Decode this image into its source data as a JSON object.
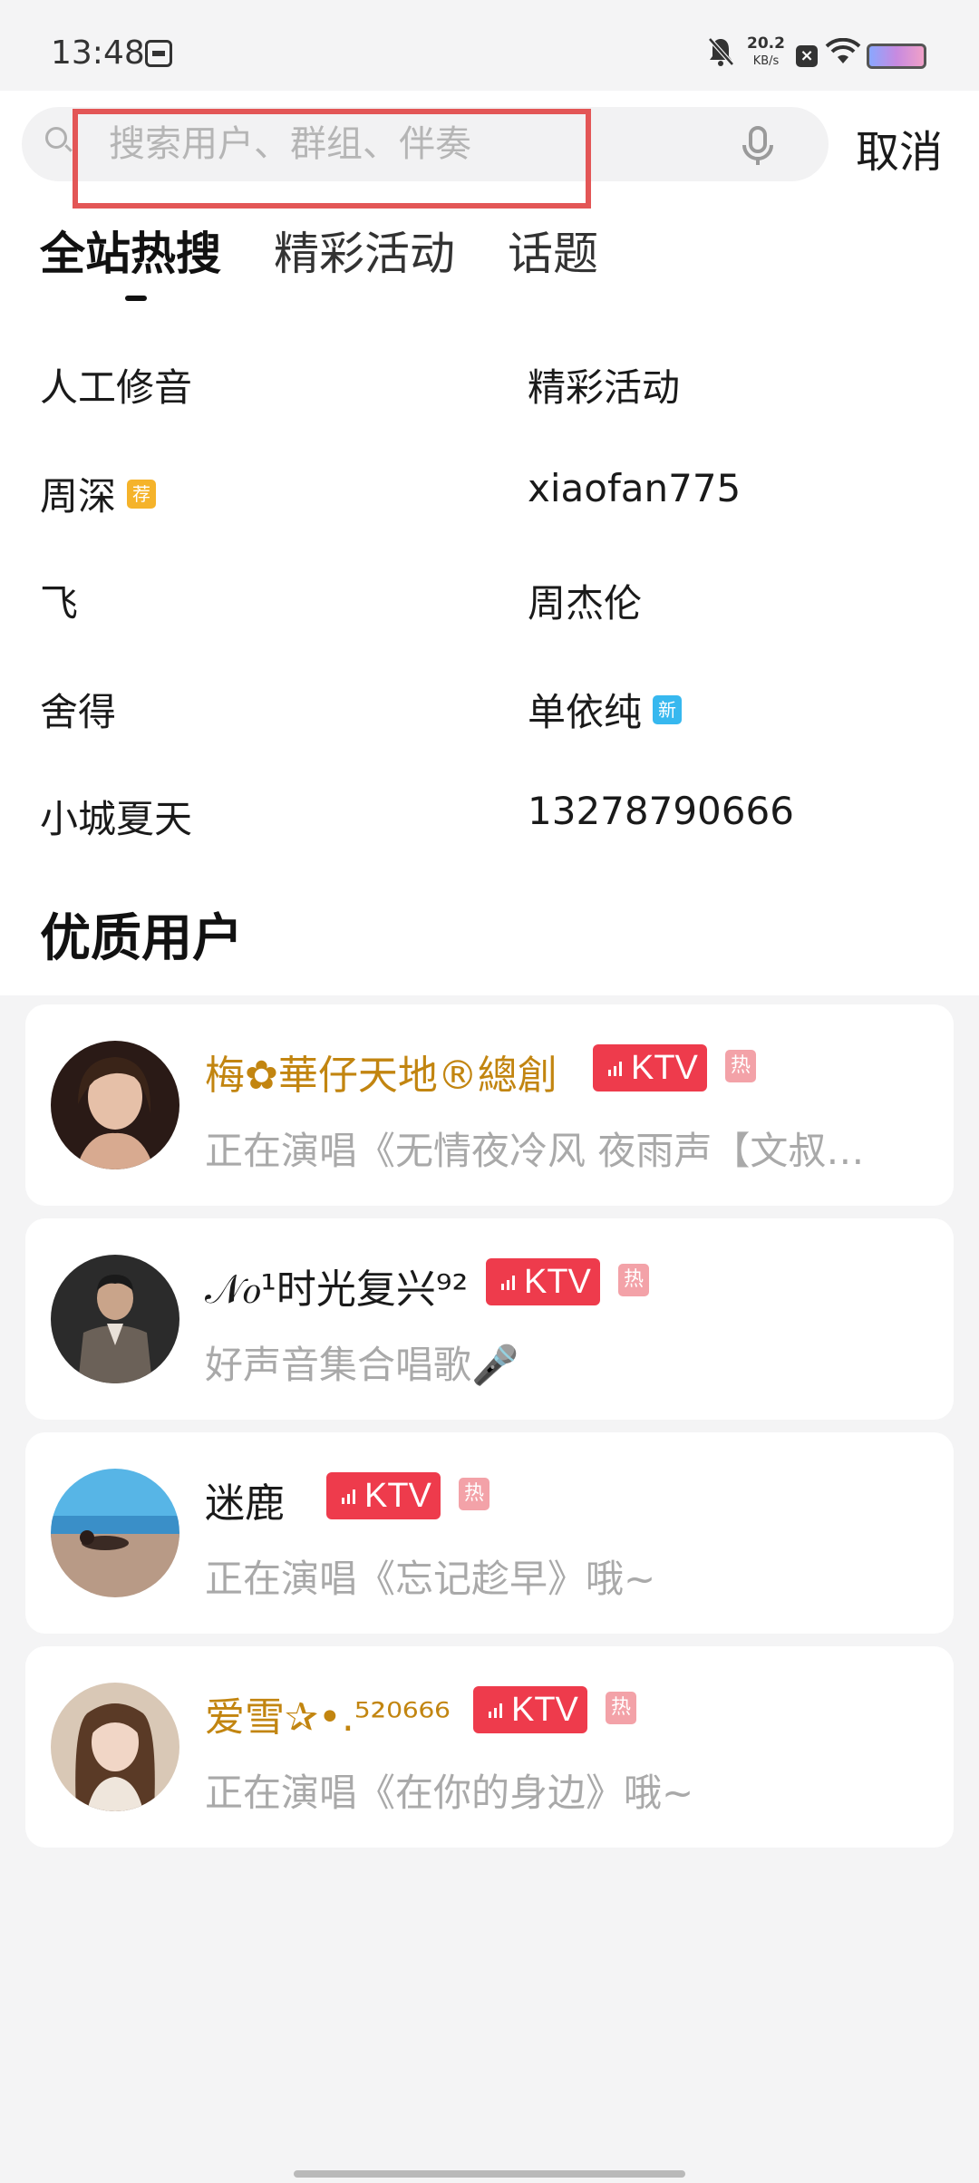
{
  "status_bar": {
    "time": "13:48",
    "net_speed": "20.2",
    "net_speed_unit": "KB/s",
    "x_label": "×"
  },
  "search": {
    "placeholder": "搜索用户、群组、伴奏",
    "value": "",
    "cancel_label": "取消"
  },
  "tabs": [
    {
      "label": "全站热搜",
      "active": true
    },
    {
      "label": "精彩活动",
      "active": false
    },
    {
      "label": "话题",
      "active": false
    }
  ],
  "hot_searches": [
    {
      "label": "人工修音",
      "tag": ""
    },
    {
      "label": "精彩活动",
      "tag": ""
    },
    {
      "label": "周深",
      "tag": "荐"
    },
    {
      "label": "xiaofan775",
      "tag": ""
    },
    {
      "label": "飞",
      "tag": ""
    },
    {
      "label": "周杰伦",
      "tag": ""
    },
    {
      "label": "舍得",
      "tag": ""
    },
    {
      "label": "单依纯",
      "tag": "新"
    },
    {
      "label": "小城夏天",
      "tag": ""
    },
    {
      "label": "13278790666",
      "tag": ""
    }
  ],
  "section_title": "优质用户",
  "users": [
    {
      "name": "梅✿華仔天地®總創",
      "badge": "KTV",
      "hot_label": "热",
      "status": "正在演唱《无情夜冷风  夜雨声【文叔…",
      "name_color": "#c28510"
    },
    {
      "name": "𝒩𝑜¹时光复兴⁹²",
      "badge": "KTV",
      "hot_label": "热",
      "status": "好声音集合唱歌🎤",
      "name_color": "#1a1a1a"
    },
    {
      "name": "迷鹿",
      "badge": "KTV",
      "hot_label": "热",
      "status": "正在演唱《忘记趁早》哦~",
      "name_color": "#1a1a1a"
    },
    {
      "name": "爱雪✰•.⁵²⁰⁶⁶⁶",
      "badge": "KTV",
      "hot_label": "热",
      "status": "正在演唱《在你的身边》哦~",
      "name_color": "#c28510"
    }
  ]
}
